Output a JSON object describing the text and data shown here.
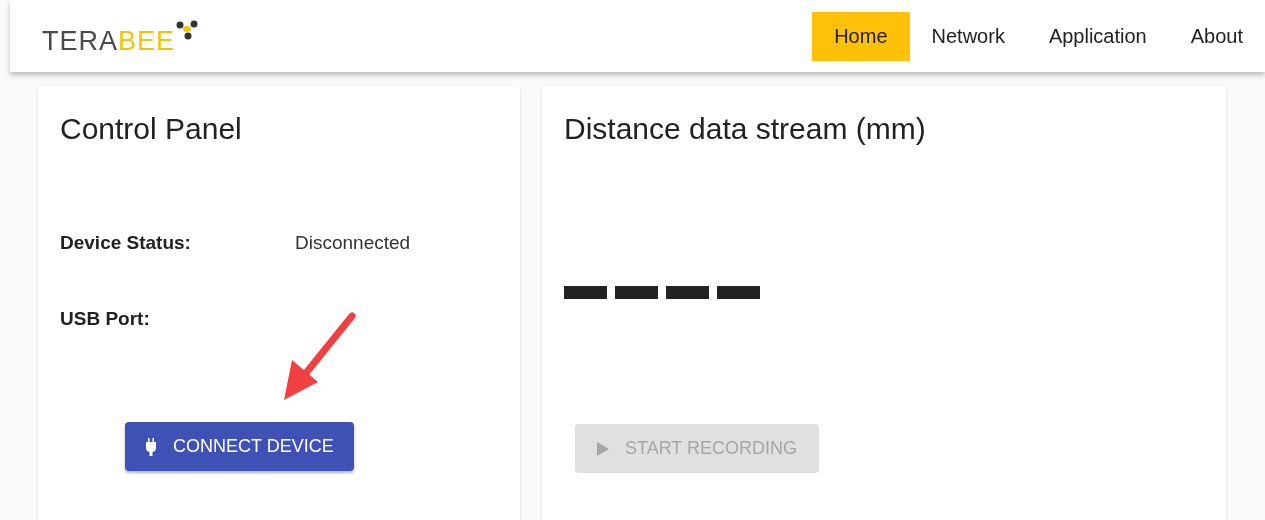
{
  "header": {
    "logo": {
      "first": "TERA",
      "second": "BEE"
    },
    "nav": [
      {
        "label": "Home",
        "selected": true
      },
      {
        "label": "Network",
        "selected": false
      },
      {
        "label": "Application",
        "selected": false
      },
      {
        "label": "About",
        "selected": false
      }
    ]
  },
  "control_panel": {
    "title": "Control Panel",
    "fields": [
      {
        "label": "Device Status:",
        "value": "Disconnected"
      },
      {
        "label": "USB Port:"
      }
    ],
    "button": {
      "label": "CONNECT DEVICE",
      "disabled": false
    }
  },
  "stream_panel": {
    "title": "Distance data stream (mm)",
    "button": {
      "label": "START RECORDING",
      "disabled": true
    }
  }
}
